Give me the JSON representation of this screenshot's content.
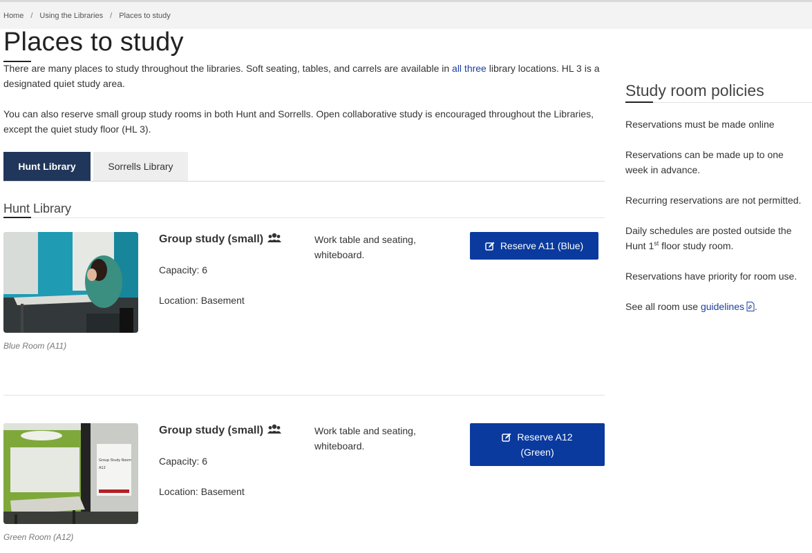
{
  "breadcrumb": {
    "home": "Home",
    "using": "Using the Libraries",
    "current": "Places to study",
    "separator": "/"
  },
  "page": {
    "title": "Places to study",
    "intro1_pre": "There are many places to study throughout the libraries.  Soft seating, tables, and carrels are available in ",
    "intro1_link": "all three",
    "intro1_post": " library locations.  HL 3 is a designated quiet study area.",
    "intro2": "You can also reserve small group study rooms in both Hunt and Sorrells. Open collaborative study is encouraged throughout the Libraries, except the quiet study floor (HL 3)."
  },
  "tabs": [
    {
      "label": "Hunt Library",
      "active": true
    },
    {
      "label": "Sorrells Library",
      "active": false
    }
  ],
  "section": {
    "heading": "Hunt Library"
  },
  "rooms": [
    {
      "type": "Group study (small)",
      "capacity": "Capacity: 6",
      "location": "Location: Basement",
      "features": "Work table and seating, whiteboard.",
      "button_line1": "Reserve A11 (Blue)",
      "button_line2": "",
      "caption": "Blue Room (A11)",
      "color": "#1f9bb3"
    },
    {
      "type": "Group study (small)",
      "capacity": "Capacity: 6",
      "location": "Location: Basement",
      "features": "Work table and seating, whiteboard.",
      "button_line1": "Reserve A12",
      "button_line2": "(Green)",
      "caption": "Green Room (A12)",
      "color": "#7fa83a",
      "sign_line1": "Group Study Room",
      "sign_line2": "A12"
    }
  ],
  "sidebar": {
    "heading": "Study room policies",
    "p1": "Reservations must be made online",
    "p2": "Reservations can be made up to one week in advance.",
    "p3": "Recurring reservations are not permitted.",
    "p4_pre": "Daily schedules are posted outside the Hunt 1",
    "p4_sup": "st",
    "p4_post": " floor study room.",
    "p5": "Reservations have priority for room use.",
    "p6_pre": "See all room use ",
    "p6_link": "guidelines",
    "p6_post": "."
  },
  "colors": {
    "tab_active": "#20365a",
    "button": "#0a3a9e",
    "link": "#1a3fa0"
  },
  "icons": {
    "group": "users-icon",
    "reserve": "edit-icon",
    "pdf": "pdf-icon"
  }
}
